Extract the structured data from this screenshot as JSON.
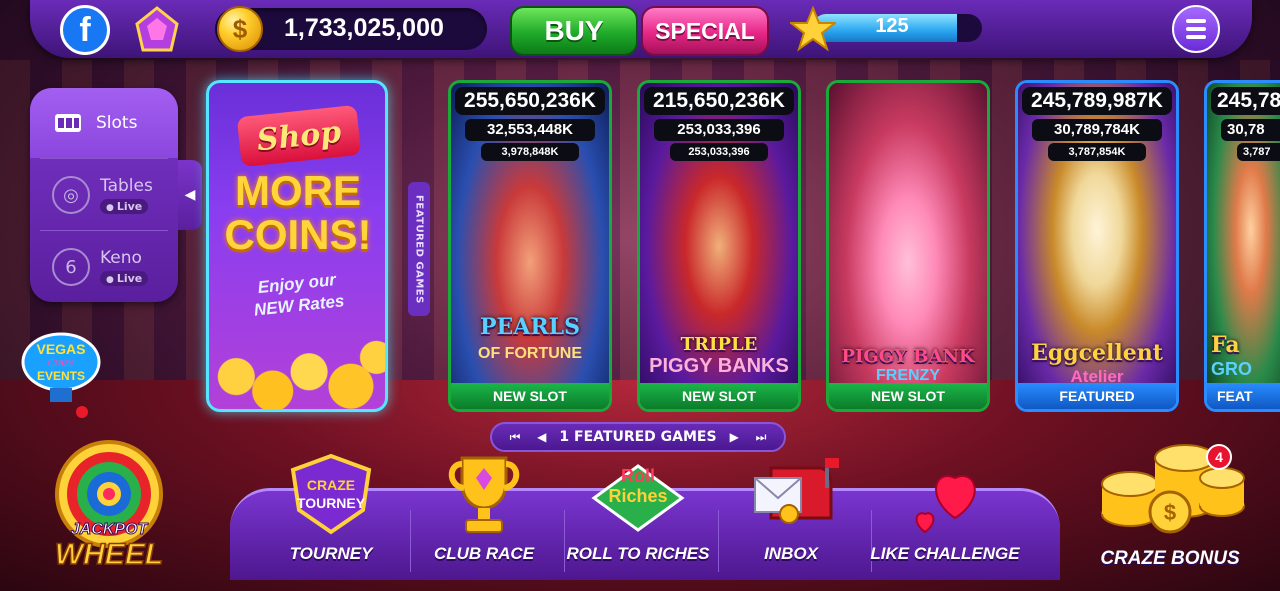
{
  "topbar": {
    "facebook_label": "f",
    "coin_symbol": "$",
    "coins": "1,733,025,000",
    "buy_label": "BUY",
    "special_label": "SPECIAL",
    "level_progress_value": "125",
    "level_progress_fraction": 0.85
  },
  "categories": [
    {
      "label": "Slots",
      "icon": "slot-machine-icon",
      "active": true
    },
    {
      "label": "Tables",
      "icon": "poker-chip-icon",
      "badge": "Live"
    },
    {
      "label": "Keno",
      "icon": "keno-ball-icon",
      "badge": "Live",
      "ball_number": "6"
    }
  ],
  "vegas_events": {
    "line1": "VEGAS",
    "line2": "Craze",
    "line3": "EVENTS"
  },
  "shop_card": {
    "title": "Shop",
    "headline_1": "MORE",
    "headline_2": "COINS!",
    "sub_1": "Enjoy our",
    "sub_2": "NEW Rates"
  },
  "featured_tab": "FEATURED GAMES",
  "games": [
    {
      "jackpot_1": "255,650,236K",
      "jackpot_2": "32,553,448K",
      "jackpot_3": "3,978,848K",
      "title_1": "PEARLS",
      "title_2": "OF FORTUNE",
      "tag": "NEW SLOT"
    },
    {
      "jackpot_1": "215,650,236K",
      "jackpot_2": "253,033,396",
      "jackpot_3": "253,033,396",
      "title_1": "TRIPLE",
      "title_2": "PIGGY BANKS",
      "tag": "NEW SLOT"
    },
    {
      "title_1": "PIGGY BANK",
      "title_2": "FRENZY",
      "tag": "NEW SLOT"
    },
    {
      "jackpot_1": "245,789,987K",
      "jackpot_2": "30,789,784K",
      "jackpot_3": "3,787,854K",
      "title_1": "Eggcellent",
      "title_2": "Atelier",
      "tag": "FEATURED"
    },
    {
      "jackpot_1": "245,78",
      "jackpot_2": "30,78",
      "jackpot_3": "3,787",
      "title_1": "Fa",
      "title_2": "GRO",
      "tag": "FEAT"
    }
  ],
  "pager": {
    "label": "1 FEATURED GAMES"
  },
  "jackpot_wheel": {
    "line1": "JACKPOT",
    "line2": "WHEEL"
  },
  "bottom_nav": [
    {
      "label": "TOURNEY",
      "icon": "tourney-shield-icon",
      "icon_line1": "CRAZE",
      "icon_line2": "TOURNEY"
    },
    {
      "label": "CLUB RACE",
      "icon": "trophy-icon"
    },
    {
      "label": "ROLL TO RICHES",
      "icon": "roll-riches-board-icon",
      "icon_line1": "Roll",
      "icon_line2": "Riches"
    },
    {
      "label": "INBOX",
      "icon": "mailbox-icon"
    },
    {
      "label": "LIKE CHALLENGE",
      "icon": "heart-icon"
    }
  ],
  "craze_bonus": {
    "label": "CRAZE BONUS",
    "badge": "4"
  },
  "colors": {
    "accent_purple": "#6a2bb8",
    "buy_green": "#1faa2a",
    "special_pink": "#e62686",
    "new_slot_green": "#1bb64a",
    "featured_blue": "#2a8cff"
  }
}
